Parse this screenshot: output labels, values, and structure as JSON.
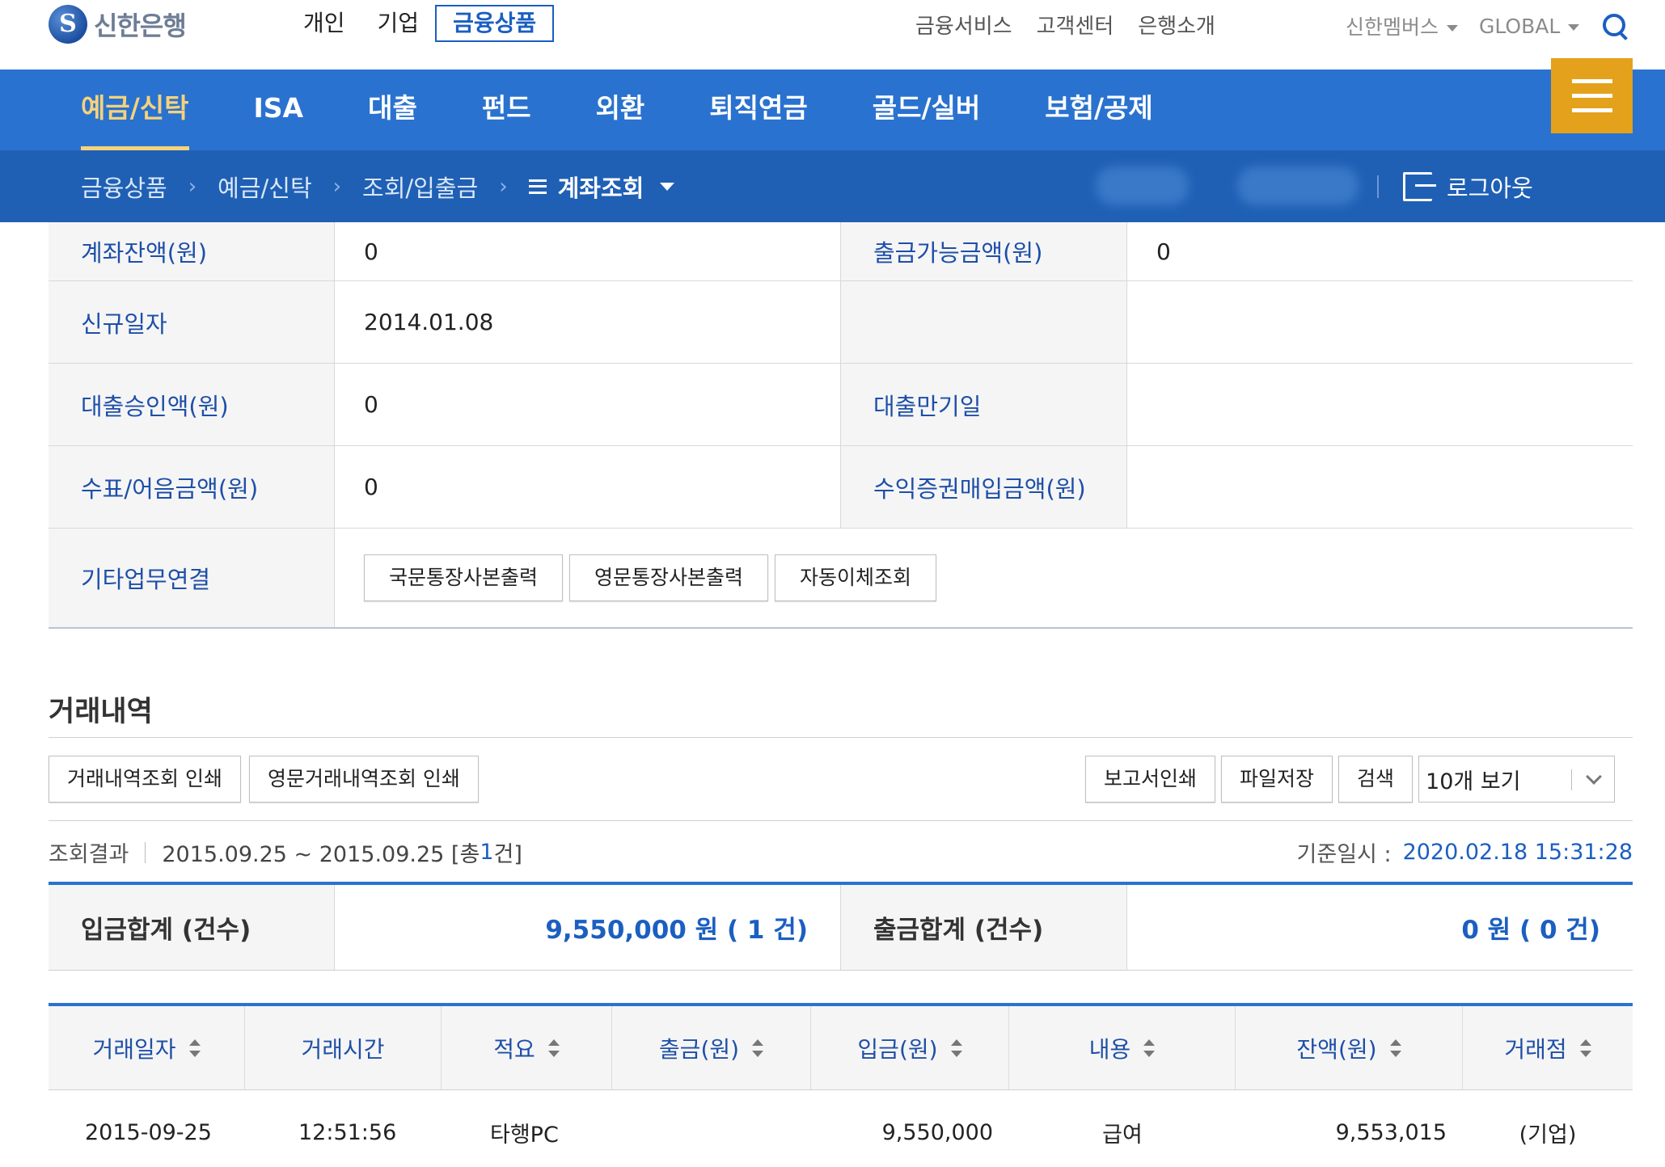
{
  "header": {
    "logo_text": "신한은행",
    "tabs": [
      "개인",
      "기업",
      "금융상품"
    ],
    "menu": [
      "금융서비스",
      "고객센터",
      "은행소개"
    ],
    "member": "신한멤버스",
    "global": "GLOBAL"
  },
  "nav": {
    "items": [
      "예금/신탁",
      "ISA",
      "대출",
      "펀드",
      "외환",
      "퇴직연금",
      "골드/실버",
      "보험/공제"
    ],
    "active_index": 0
  },
  "breadcrumb": {
    "items": [
      "금융상품",
      "예금/신탁",
      "조회/입출금"
    ],
    "current": "계좌조회",
    "logout": "로그아웃"
  },
  "account_info": {
    "rows": [
      {
        "label1": "계좌잔액(원)",
        "value1": "0",
        "label2": "출금가능금액(원)",
        "value2": "0"
      },
      {
        "label1": "신규일자",
        "value1": "2014.01.08",
        "label2": "",
        "value2": ""
      },
      {
        "label1": "대출승인액(원)",
        "value1": "0",
        "label2": "대출만기일",
        "value2": ""
      },
      {
        "label1": "수표/어음금액(원)",
        "value1": "0",
        "label2": "수익증권매입금액(원)",
        "value2": ""
      }
    ],
    "other_label": "기타업무연결",
    "other_buttons": [
      "국문통장사본출력",
      "영문통장사본출력",
      "자동이체조회"
    ]
  },
  "transactions": {
    "title": "거래내역",
    "left_buttons": [
      "거래내역조회 인쇄",
      "영문거래내역조회 인쇄"
    ],
    "right_buttons": [
      "보고서인쇄",
      "파일저장",
      "검색"
    ],
    "page_size": "10개 보기",
    "result_label": "조회결과",
    "result_range": "2015.09.25 ~ 2015.09.25 [총",
    "result_count": "1",
    "result_suffix": "건]",
    "base_time_label": "기준일시 :",
    "base_time": "2020.02.18 15:31:28",
    "deposit_sum_label": "입금합계 (건수)",
    "deposit_sum": "9,550,000 원 ( 1 건)",
    "withdraw_sum_label": "출금합계 (건수)",
    "withdraw_sum": "0 원 ( 0 건)",
    "columns": [
      "거래일자",
      "거래시간",
      "적요",
      "출금(원)",
      "입금(원)",
      "내용",
      "잔액(원)",
      "거래점"
    ],
    "rows": [
      {
        "date": "2015-09-25",
        "time": "12:51:56",
        "memo": "타행PC",
        "withdraw": "",
        "deposit": "9,550,000",
        "content": "급여",
        "balance": "9,553,015",
        "branch": "(기업)"
      }
    ]
  }
}
